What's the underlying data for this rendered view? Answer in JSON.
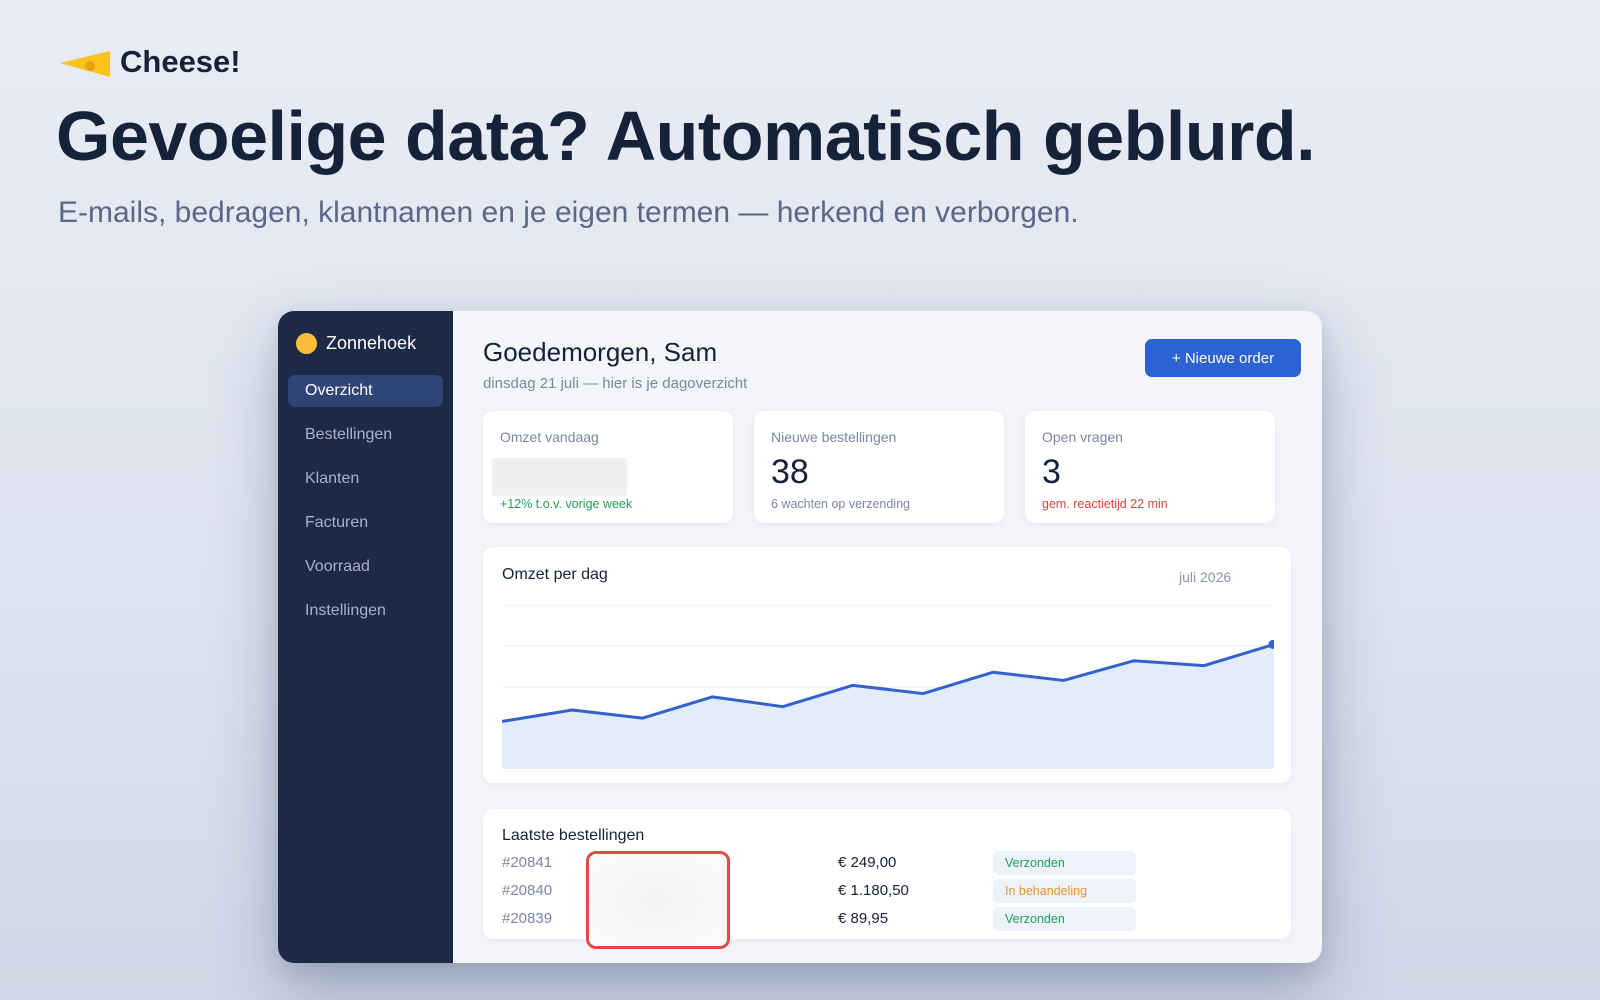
{
  "brand": {
    "name": "Cheese!",
    "icon": "cheese-wedge-icon"
  },
  "hero": {
    "headline": "Gevoelige data? Automatisch geblurd.",
    "subline": "E-mails, bedragen, klantnamen en je eigen termen — herkend en verborgen."
  },
  "app": {
    "workspace": "Zonnehoek",
    "nav": [
      {
        "label": "Overzicht",
        "active": true
      },
      {
        "label": "Bestellingen",
        "active": false
      },
      {
        "label": "Klanten",
        "active": false
      },
      {
        "label": "Facturen",
        "active": false
      },
      {
        "label": "Voorraad",
        "active": false
      },
      {
        "label": "Instellingen",
        "active": false
      }
    ],
    "greeting": "Goedemorgen, Sam",
    "date_line": "dinsdag 21 juli — hier is je dagoverzicht",
    "new_order_label": "+ Nieuwe order",
    "stats": [
      {
        "label": "Omzet vandaag",
        "value": "",
        "note": "+12% t.o.v. vorige week"
      },
      {
        "label": "Nieuwe bestellingen",
        "value": "38",
        "note": "6 wachten op verzending"
      },
      {
        "label": "Open vragen",
        "value": "3",
        "note": "gem. reactietijd 22 min"
      }
    ],
    "chart": {
      "title": "Omzet per dag",
      "period": "juli 2026"
    },
    "orders": {
      "title": "Laatste bestellingen",
      "rows": [
        {
          "id": "#20841",
          "amount": "€ 249,00",
          "status": "Verzonden"
        },
        {
          "id": "#20840",
          "amount": "€ 1.180,50",
          "status": "In behandeling"
        },
        {
          "id": "#20839",
          "amount": "€ 89,95",
          "status": "Verzonden"
        }
      ]
    }
  },
  "chart_data": {
    "type": "area",
    "title": "Omzet per dag",
    "x": [
      1,
      2,
      3,
      4,
      5,
      6,
      7,
      8,
      9,
      10,
      11,
      12
    ],
    "values": [
      29,
      36,
      31,
      44,
      38,
      51,
      46,
      59,
      54,
      66,
      63,
      76
    ],
    "ylim": [
      0,
      100
    ],
    "grid": true,
    "colors": {
      "line": "#3162cf",
      "fill": "#e3ecfa"
    }
  },
  "colors": {
    "accent": "#2d62d2",
    "sidebar": "#1c2a46",
    "positive": "#1f9e5a",
    "negative": "#d9453c",
    "pending": "#e3962b",
    "highlight": "#e24a4a"
  }
}
